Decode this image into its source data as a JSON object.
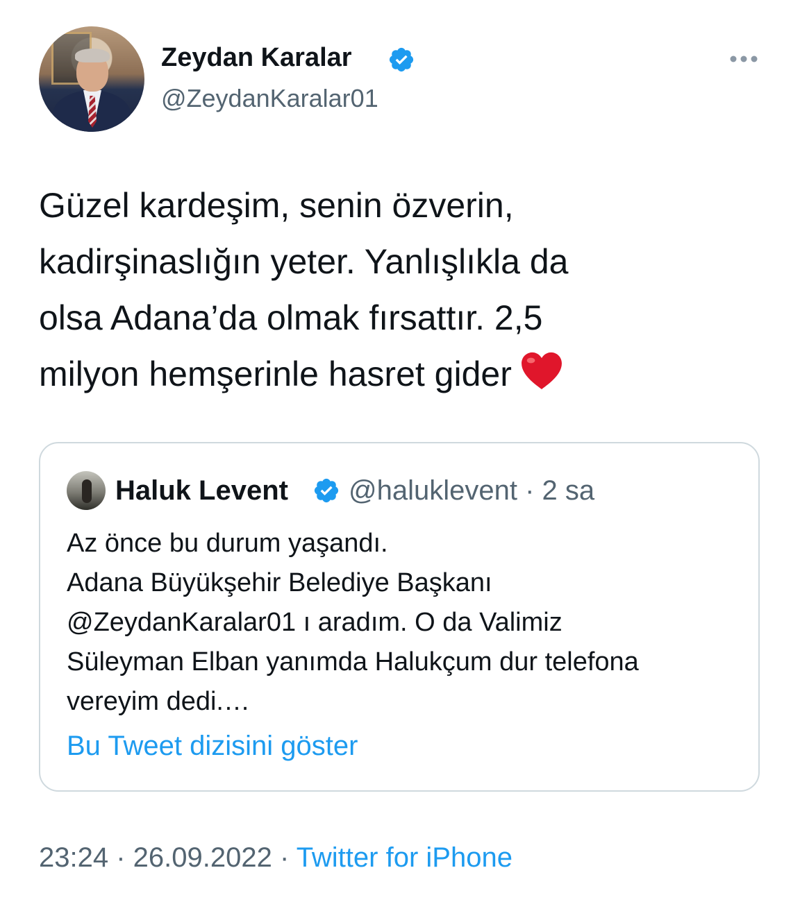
{
  "tweet": {
    "author_name": "Zeydan Karalar",
    "author_handle": "@ZeydanKaralar01",
    "text": "Güzel kardeşim, senin özverin,\nkadirşinaslığın yeter. Yanlışlıkla da\nolsa Adana’da olmak fırsattır. 2,5\nmilyon hemşerinle hasret gider",
    "emoji_icon": "red-heart-icon",
    "time": "23:24",
    "date": "26.09.2022",
    "separator": " · ",
    "source": "Twitter for iPhone"
  },
  "quoted_tweet": {
    "author_name": "Haluk Levent",
    "meta": "@haluklevent · 2 sa",
    "text": "Az önce bu durum yaşandı.\nAdana Büyükşehir Belediye Başkanı\n@ZeydanKaralar01 ı aradım. O da Valimiz\nSüleyman Elban yanımda Halukçum dur telefona\nvereyim dedi.…",
    "show_thread_label": "Bu Tweet dizisini göster"
  },
  "colors": {
    "text": "#0f1419",
    "secondary": "#536471",
    "link": "#1d9bf0",
    "border": "#cfd9de",
    "verified": "#1d9bf0",
    "heart": "#e0162b"
  }
}
